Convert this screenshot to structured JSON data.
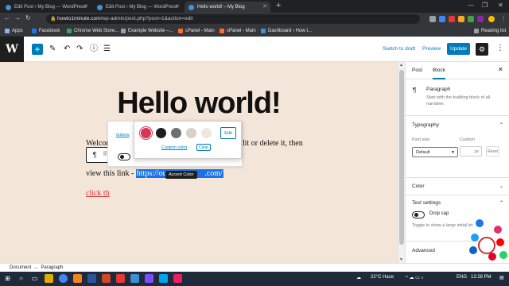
{
  "browser": {
    "tabs": [
      {
        "title": "Edit Post ‹ My Blog — WordPress"
      },
      {
        "title": "Edit Post ‹ My Blog — WordPress"
      },
      {
        "title": "Hello world! – My Blog"
      }
    ],
    "url_domain": "howto1minute.com",
    "url_path": "/wp-admin/post.php?post=1&action=edit",
    "bookmarks": [
      "Apps",
      "Facebook",
      "Chrome Web Store...",
      "Example Website –...",
      "cPanel - Main",
      "cPanel - Main",
      "Dashboard ‹ How t..."
    ],
    "reading_list": "Reading list"
  },
  "editor": {
    "switch_to_draft": "Switch to draft",
    "preview": "Preview",
    "update": "Update"
  },
  "post": {
    "title": "Hello world!",
    "line1": "Welcome to WordPress. This is your first post. Edit or delete it, then",
    "line2_prefix": "view this link - ",
    "line2_link": "https://out",
    "line2_link_end": ".com/",
    "line3_link": "click th"
  },
  "tooltip": "Accent Color",
  "link_popover": {
    "url_fragment": "outsou"
  },
  "color_popover": {
    "swatches": [
      "#d63655",
      "#1e1e1e",
      "#707070",
      "#d8d0c6",
      "#efe6dc"
    ],
    "custom_color": "Custom color",
    "clear": "Clear",
    "edit": "Edit"
  },
  "sidebar": {
    "tabs": [
      "Post",
      "Block"
    ],
    "block_name": "Paragraph",
    "block_desc": "Start with the building block of all narrative.",
    "typography": "Typography",
    "font_size": "Font size",
    "custom": "Custom",
    "font_size_value": "Default",
    "px_unit": "px",
    "reset": "Reset",
    "color": "Color",
    "text_settings": "Text settings",
    "drop_cap": "Drop cap",
    "drop_cap_help": "Toggle to show a large initial let",
    "advanced": "Advanced"
  },
  "footer": {
    "crumbs": [
      "Document",
      "Paragraph"
    ]
  },
  "taskbar": {
    "weather": "22°C Haze",
    "lang": "ENG",
    "time": "12:28 PM"
  }
}
